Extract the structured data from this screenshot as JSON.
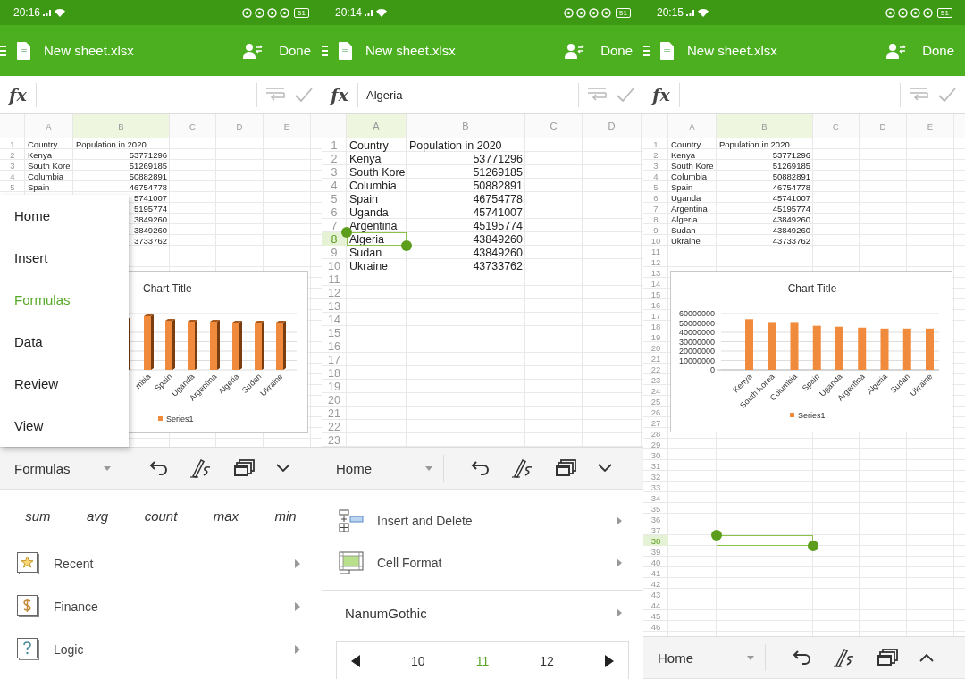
{
  "panels": [
    {
      "status_bar": {
        "time": "20:16",
        "battery": "51"
      },
      "app_bar": {
        "title": "New sheet.xlsx",
        "action": "Done"
      },
      "formula_bar": {
        "label": "fx"
      },
      "sheet": {
        "zoomed": false,
        "columns": [
          {
            "label": "A",
            "selected": false
          },
          {
            "label": "B",
            "selected": true
          },
          {
            "label": "C",
            "selected": false
          },
          {
            "label": "D",
            "selected": false
          },
          {
            "label": "E",
            "selected": false
          }
        ],
        "rows": [
          {
            "number": "1",
            "a": "Country",
            "b": "Population in 2020",
            "selected": false
          },
          {
            "number": "2",
            "a": "Kenya",
            "b": "53771296",
            "selected": false
          },
          {
            "number": "3",
            "a": "South Kore",
            "b": "51269185",
            "selected": false
          },
          {
            "number": "4",
            "a": "Columbia",
            "b": "50882891",
            "selected": false
          },
          {
            "number": "5",
            "a": "Spain",
            "b": "46754778",
            "selected": false
          },
          {
            "b": "5741007",
            "selected": false
          },
          {
            "b": "5195774",
            "selected": false
          },
          {
            "b": "3849260",
            "selected": false
          },
          {
            "b": "3849260",
            "selected": false
          },
          {
            "b": "3733762",
            "selected": false
          }
        ]
      },
      "chart": {
        "title": "Chart Title",
        "category_labels": [
          "mbia",
          "Spain",
          "Uganda",
          "Argentina",
          "Algeria",
          "Sudan",
          "Ukraine"
        ],
        "legend": "Series1"
      },
      "menu": {
        "items": [
          {
            "label": "Home",
            "selected": false
          },
          {
            "label": "Insert",
            "selected": false
          },
          {
            "label": "Formulas",
            "selected": true
          },
          {
            "label": "Data",
            "selected": false
          },
          {
            "label": "Review",
            "selected": false
          },
          {
            "label": "View",
            "selected": false
          }
        ]
      },
      "toolbar": {
        "tab": "Formulas",
        "ribbon_expanded": true
      },
      "ribbon": {
        "kind": "formulas",
        "functions": [
          "sum",
          "avg",
          "count",
          "max",
          "min"
        ],
        "items": [
          {
            "label": "Recent"
          },
          {
            "label": "Finance"
          },
          {
            "label": "Logic"
          }
        ]
      }
    },
    {
      "status_bar": {
        "time": "20:14",
        "battery": "51"
      },
      "app_bar": {
        "title": "New sheet.xlsx",
        "action": "Done"
      },
      "formula_bar": {
        "label": "fx",
        "value": "Algeria"
      },
      "sheet": {
        "zoomed": true,
        "columns": [
          {
            "label": "A",
            "selected": true
          },
          {
            "label": "B",
            "selected": false
          },
          {
            "label": "C",
            "selected": false
          },
          {
            "label": "D",
            "selected": false
          }
        ],
        "rows": [
          {
            "number": "1",
            "a": "Country",
            "b": "Population in 2020",
            "selected": false
          },
          {
            "number": "2",
            "a": "Kenya",
            "b": "53771296",
            "selected": false
          },
          {
            "number": "3",
            "a": "South Kore",
            "b": "51269185",
            "selected": false
          },
          {
            "number": "4",
            "a": "Columbia",
            "b": "50882891",
            "selected": false
          },
          {
            "number": "5",
            "a": "Spain",
            "b": "46754778",
            "selected": false
          },
          {
            "number": "6",
            "a": "Uganda",
            "b": "45741007",
            "selected": false
          },
          {
            "number": "7",
            "a": "Argentina",
            "b": "45195774",
            "selected": false
          },
          {
            "number": "8",
            "a": "Algeria",
            "b": "43849260",
            "selected": true
          },
          {
            "number": "9",
            "a": "Sudan",
            "b": "43849260",
            "selected": false
          },
          {
            "number": "10",
            "a": "Ukraine",
            "b": "43733762",
            "selected": false
          },
          {
            "number": "11",
            "selected": false
          },
          {
            "number": "12",
            "selected": false
          },
          {
            "number": "13",
            "selected": false
          },
          {
            "number": "14",
            "selected": false
          },
          {
            "number": "15",
            "selected": false
          },
          {
            "number": "16",
            "selected": false
          },
          {
            "number": "17",
            "selected": false
          },
          {
            "number": "18",
            "selected": false
          },
          {
            "number": "19",
            "selected": false
          },
          {
            "number": "20",
            "selected": false
          },
          {
            "number": "21",
            "selected": false
          },
          {
            "number": "22",
            "selected": false
          },
          {
            "number": "23",
            "selected": false
          }
        ]
      },
      "toolbar": {
        "tab": "Home",
        "ribbon_expanded": true
      },
      "ribbon": {
        "kind": "home",
        "items": [
          {
            "label": "Insert and Delete"
          },
          {
            "label": "Cell Format"
          }
        ],
        "font": "NanumGothic",
        "font_sizes": [
          {
            "label": "10",
            "selected": false
          },
          {
            "label": "11",
            "selected": true
          },
          {
            "label": "12",
            "selected": false
          }
        ]
      }
    },
    {
      "status_bar": {
        "time": "20:15",
        "battery": "51"
      },
      "app_bar": {
        "title": "New sheet.xlsx",
        "action": "Done"
      },
      "formula_bar": {
        "label": "fx"
      },
      "sheet": {
        "zoomed": false,
        "columns": [
          {
            "label": "A",
            "selected": false
          },
          {
            "label": "B",
            "selected": true
          },
          {
            "label": "C",
            "selected": false
          },
          {
            "label": "D",
            "selected": false
          },
          {
            "label": "E",
            "selected": false
          }
        ],
        "rows": [
          {
            "number": "1",
            "a": "Country",
            "b": "Population in 2020",
            "selected": false
          },
          {
            "number": "2",
            "a": "Kenya",
            "b": "53771296",
            "selected": false
          },
          {
            "number": "3",
            "a": "South Kore",
            "b": "51269185",
            "selected": false
          },
          {
            "number": "4",
            "a": "Columbia",
            "b": "50882891",
            "selected": false
          },
          {
            "number": "5",
            "a": "Spain",
            "b": "46754778",
            "selected": false
          },
          {
            "number": "6",
            "a": "Uganda",
            "b": "45741007",
            "selected": false
          },
          {
            "number": "7",
            "a": "Argentina",
            "b": "45195774",
            "selected": false
          },
          {
            "number": "8",
            "a": "Algeria",
            "b": "43849260",
            "selected": false
          },
          {
            "number": "9",
            "a": "Sudan",
            "b": "43849260",
            "selected": false
          },
          {
            "number": "10",
            "a": "Ukraine",
            "b": "43733762",
            "selected": false
          },
          {
            "number": "11",
            "selected": false
          },
          {
            "number": "12",
            "selected": false
          },
          {
            "number": "13",
            "selected": false
          },
          {
            "number": "14",
            "selected": false
          },
          {
            "number": "15",
            "selected": false
          },
          {
            "number": "16",
            "selected": false
          },
          {
            "number": "17",
            "selected": false
          },
          {
            "number": "18",
            "selected": false
          },
          {
            "number": "19",
            "selected": false
          },
          {
            "number": "20",
            "selected": false
          },
          {
            "number": "21",
            "selected": false
          },
          {
            "number": "22",
            "selected": false
          },
          {
            "number": "23",
            "selected": false
          },
          {
            "number": "24",
            "selected": false
          },
          {
            "number": "25",
            "selected": false
          },
          {
            "number": "26",
            "selected": false
          },
          {
            "number": "27",
            "selected": false
          },
          {
            "number": "28",
            "selected": false
          },
          {
            "number": "29",
            "selected": false
          },
          {
            "number": "30",
            "selected": false
          },
          {
            "number": "31",
            "selected": false
          },
          {
            "number": "32",
            "selected": false
          },
          {
            "number": "33",
            "selected": false
          },
          {
            "number": "34",
            "selected": false
          },
          {
            "number": "35",
            "selected": false
          },
          {
            "number": "36",
            "selected": false
          },
          {
            "number": "37",
            "selected": false
          },
          {
            "number": "38",
            "selected": true
          },
          {
            "number": "39",
            "selected": false
          },
          {
            "number": "40",
            "selected": false
          },
          {
            "number": "41",
            "selected": false
          },
          {
            "number": "42",
            "selected": false
          },
          {
            "number": "43",
            "selected": false
          },
          {
            "number": "44",
            "selected": false
          },
          {
            "number": "45",
            "selected": false
          },
          {
            "number": "46",
            "selected": false
          }
        ]
      },
      "chart": {
        "chart_data": {
          "type": "bar",
          "title": "Chart Title",
          "categories": [
            "Kenya",
            "South Korea",
            "Columbia",
            "Spain",
            "Uganda",
            "Argentina",
            "Algeria",
            "Sudan",
            "Ukraine"
          ],
          "series": [
            {
              "name": "Series1",
              "color": "#f08a3c",
              "values": [
                54000000,
                51000000,
                51000000,
                47000000,
                46000000,
                45000000,
                44000000,
                44000000,
                44000000
              ]
            }
          ],
          "grid": true,
          "ylim": [
            0,
            60000000
          ],
          "yticks": [
            0,
            10000000,
            20000000,
            30000000,
            40000000,
            50000000,
            60000000
          ]
        }
      },
      "toolbar": {
        "tab": "Home",
        "ribbon_expanded": false
      }
    }
  ]
}
